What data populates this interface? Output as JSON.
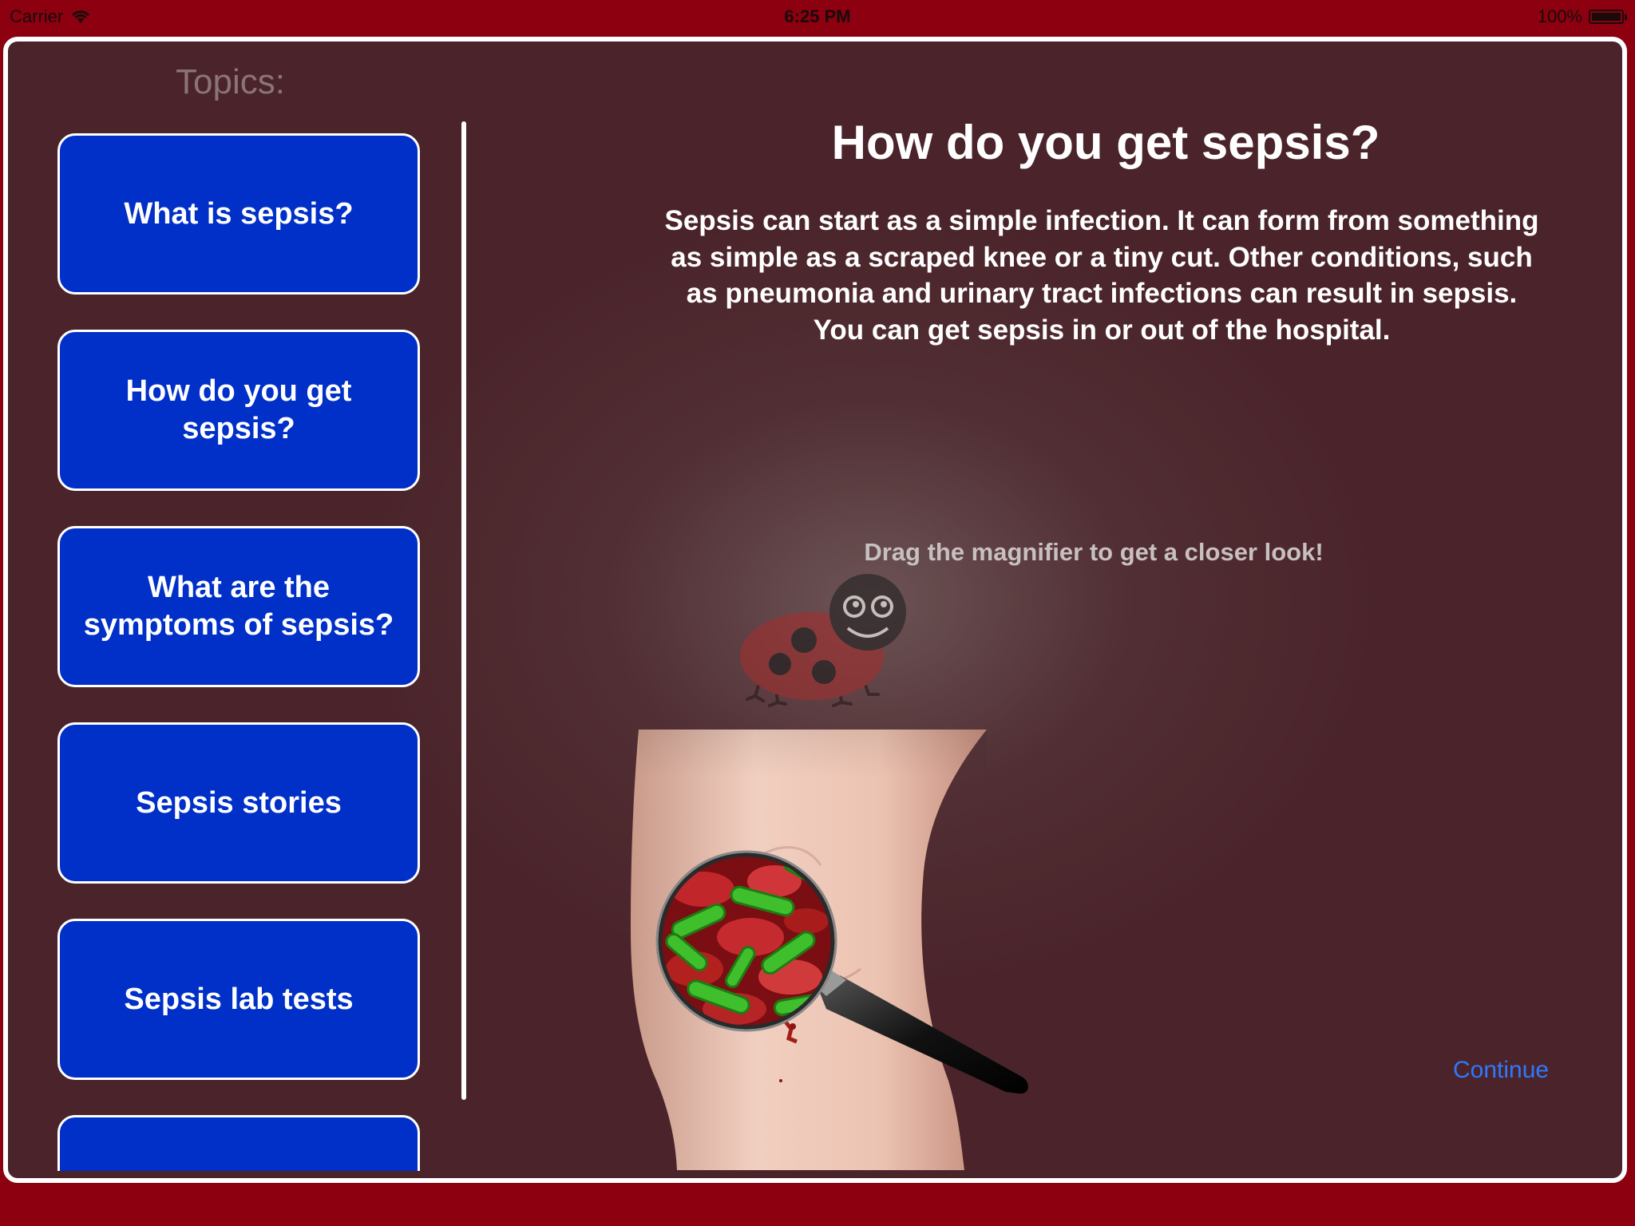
{
  "status_bar": {
    "carrier": "Carrier",
    "time": "6:25 PM",
    "battery": "100%"
  },
  "sidebar": {
    "title": "Topics:",
    "items": [
      {
        "label": "What is sepsis?"
      },
      {
        "label": "How do you get sepsis?"
      },
      {
        "label": "What are the symptoms of sepsis?"
      },
      {
        "label": "Sepsis stories"
      },
      {
        "label": "Sepsis lab tests"
      },
      {
        "label": ""
      }
    ]
  },
  "content": {
    "title": "How do you get sepsis?",
    "body": "Sepsis can start as a simple infection.  It can form from something as simple as a scraped knee or a tiny cut.  Other conditions, such as pneumonia and urinary tract infections can result in sepsis.  You can get sepsis in or out of the hospital.",
    "hint": "Drag the magnifier to get a closer look!",
    "continue_label": "Continue"
  },
  "colors": {
    "frame": "#8c0010",
    "panel": "#4a242a",
    "button": "#0030c8",
    "link": "#2f78ff"
  },
  "icons": [
    "wifi-icon",
    "battery-icon",
    "ladybug-icon",
    "magnifier-icon"
  ]
}
